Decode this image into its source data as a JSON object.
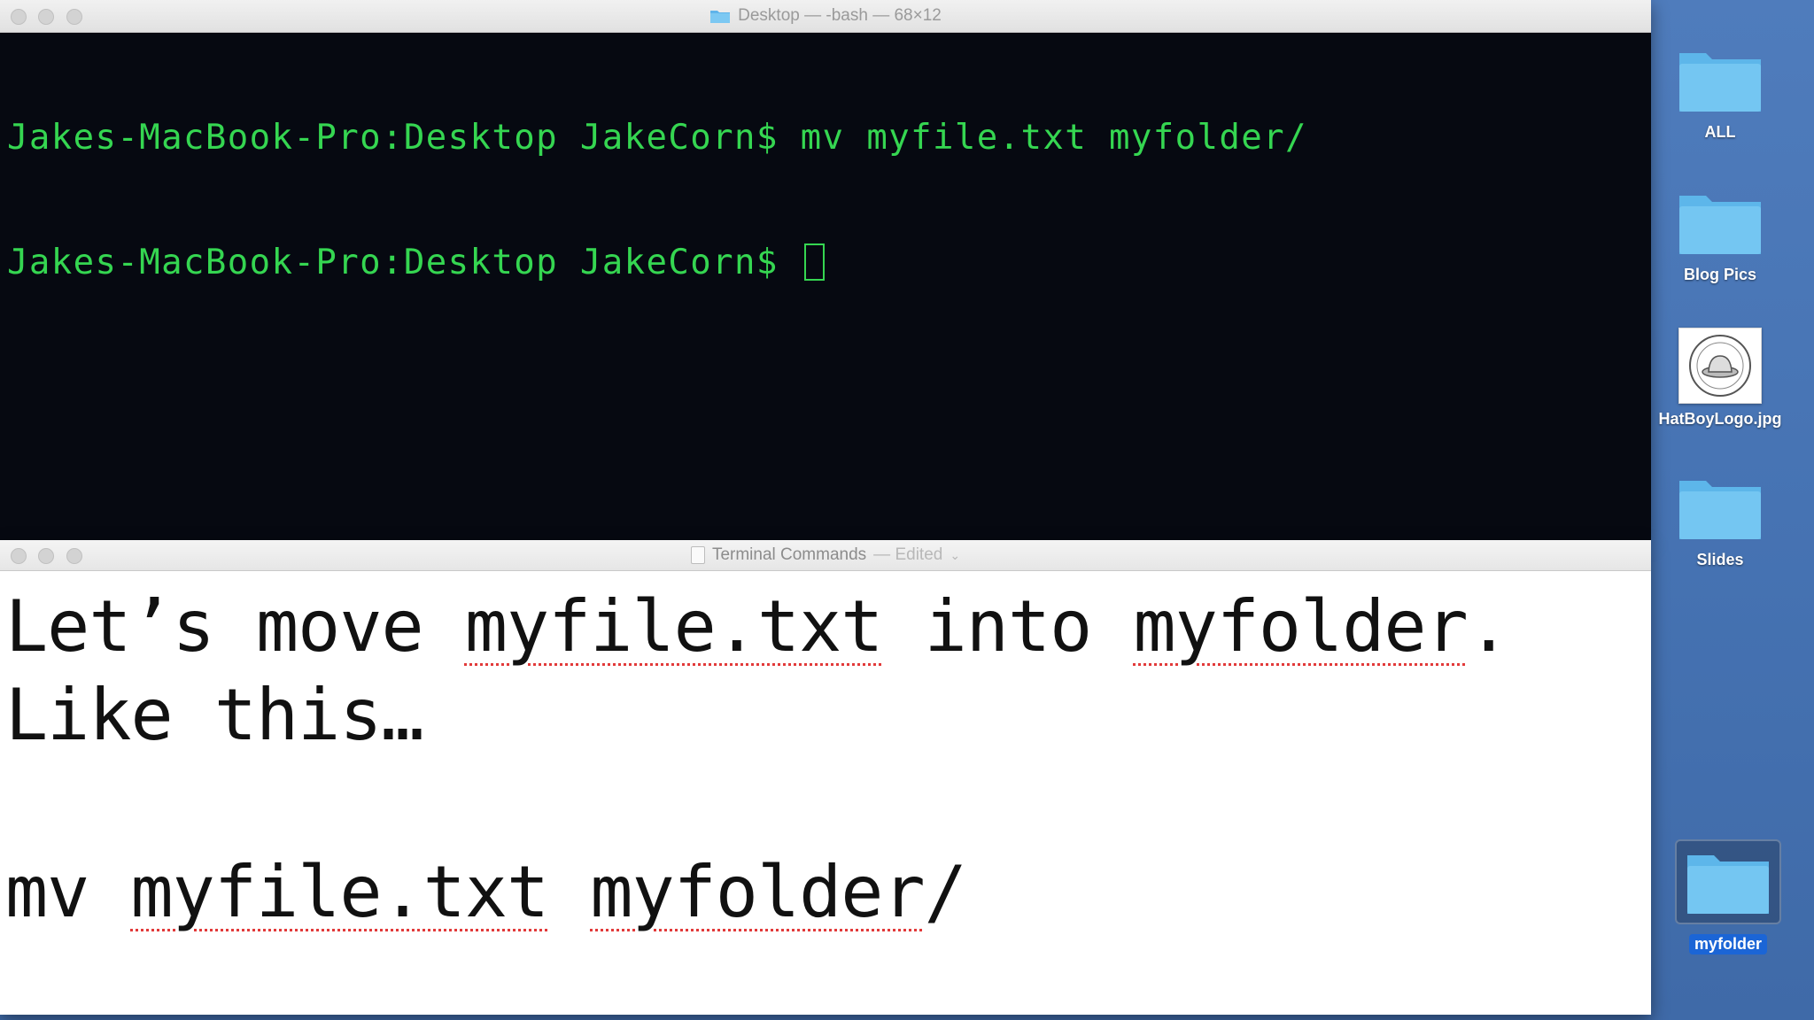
{
  "terminal": {
    "title": "Desktop — -bash — 68×12",
    "lines": [
      "Jakes-MacBook-Pro:Desktop JakeCorn$ mv myfile.txt myfolder/",
      "Jakes-MacBook-Pro:Desktop JakeCorn$ "
    ]
  },
  "editor": {
    "title": "Terminal Commands",
    "status": "— Edited",
    "line1": {
      "a": "Let’s move ",
      "b": "myfile.txt",
      "c": " into ",
      "d": "myfolder",
      "e": "."
    },
    "line2": "Like this…",
    "line4": {
      "a": "mv ",
      "b": "myfile.txt",
      "c": " ",
      "d": "myfolder",
      "e": "/"
    }
  },
  "desktop": {
    "icons": [
      {
        "label": "ALL",
        "kind": "folder-icon"
      },
      {
        "label": "Blog Pics",
        "kind": "folder-icon"
      },
      {
        "label": "HatBoyLogo.jpg",
        "kind": "image-thumbnail-icon"
      },
      {
        "label": "Slides",
        "kind": "folder-icon"
      },
      {
        "label": "myfolder",
        "kind": "folder-icon",
        "selected": true
      }
    ]
  },
  "colors": {
    "terminal_text": "#35d651",
    "terminal_bg": "#060911",
    "folder_blue": "#6cc3f0",
    "selection_blue": "#1b65d6",
    "spellcheck_red": "#e23a3a"
  }
}
